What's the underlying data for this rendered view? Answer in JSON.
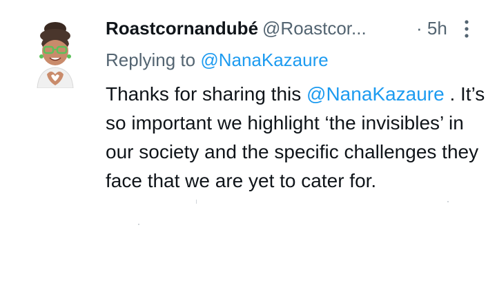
{
  "tweet": {
    "display_name": "Roastcornandubé",
    "handle": "@Roastcor...",
    "time": "· 5h",
    "reply_prefix": "Replying to",
    "reply_mention": "@NanaKazaure",
    "text_part1": "Thanks for sharing this ",
    "text_mention": "@NanaKazaure",
    "text_part2": " . It’s so important we highlight ‘the invisibles’ in our society and the specific challenges they face that we are yet to cater for.",
    "icons": {
      "avatar": "memoji-avatar",
      "more": "more-vertical-icon"
    },
    "colors": {
      "link": "#1d9bf0",
      "secondary": "#536471",
      "primary": "#0f1419"
    }
  }
}
